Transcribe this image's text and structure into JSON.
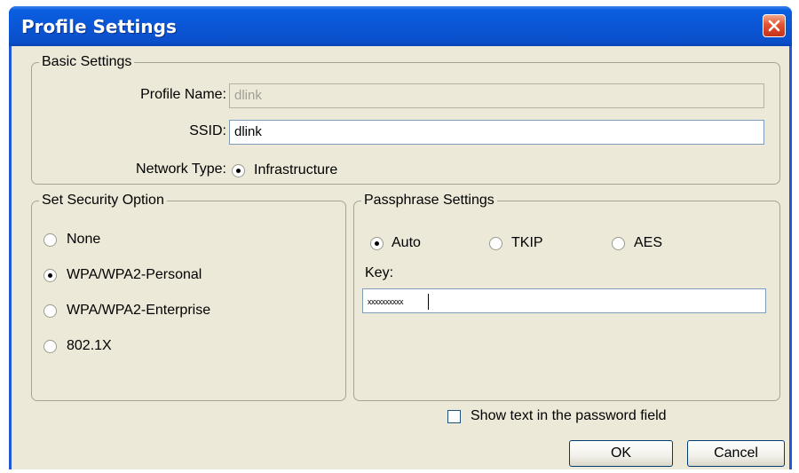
{
  "window": {
    "title": "Profile Settings",
    "close_icon": "close-icon"
  },
  "basic_settings": {
    "legend": "Basic Settings",
    "profile_name_label": "Profile Name:",
    "profile_name_value": "dlink",
    "ssid_label": "SSID:",
    "ssid_value": "dlink",
    "network_type_label": "Network Type:",
    "network_type_option": "Infrastructure",
    "network_type_selected": true
  },
  "security_option": {
    "legend": "Set Security Option",
    "options": [
      {
        "label": "None",
        "selected": false
      },
      {
        "label": "WPA/WPA2-Personal",
        "selected": true
      },
      {
        "label": "WPA/WPA2-Enterprise",
        "selected": false
      },
      {
        "label": "802.1X",
        "selected": false
      }
    ]
  },
  "passphrase_settings": {
    "legend": "Passphrase Settings",
    "cipher_options": [
      {
        "label": "Auto",
        "selected": true
      },
      {
        "label": "TKIP",
        "selected": false
      },
      {
        "label": "AES",
        "selected": false
      }
    ],
    "key_label": "Key:",
    "key_value": "xxxxxxxxxx"
  },
  "show_text": {
    "label": "Show text in the password field",
    "checked": false
  },
  "buttons": {
    "ok_label": "OK",
    "cancel_label": "Cancel"
  },
  "colors": {
    "titlebar": "#0a56d6",
    "dialog_background": "#ece9d8",
    "close_button": "#e35330"
  }
}
